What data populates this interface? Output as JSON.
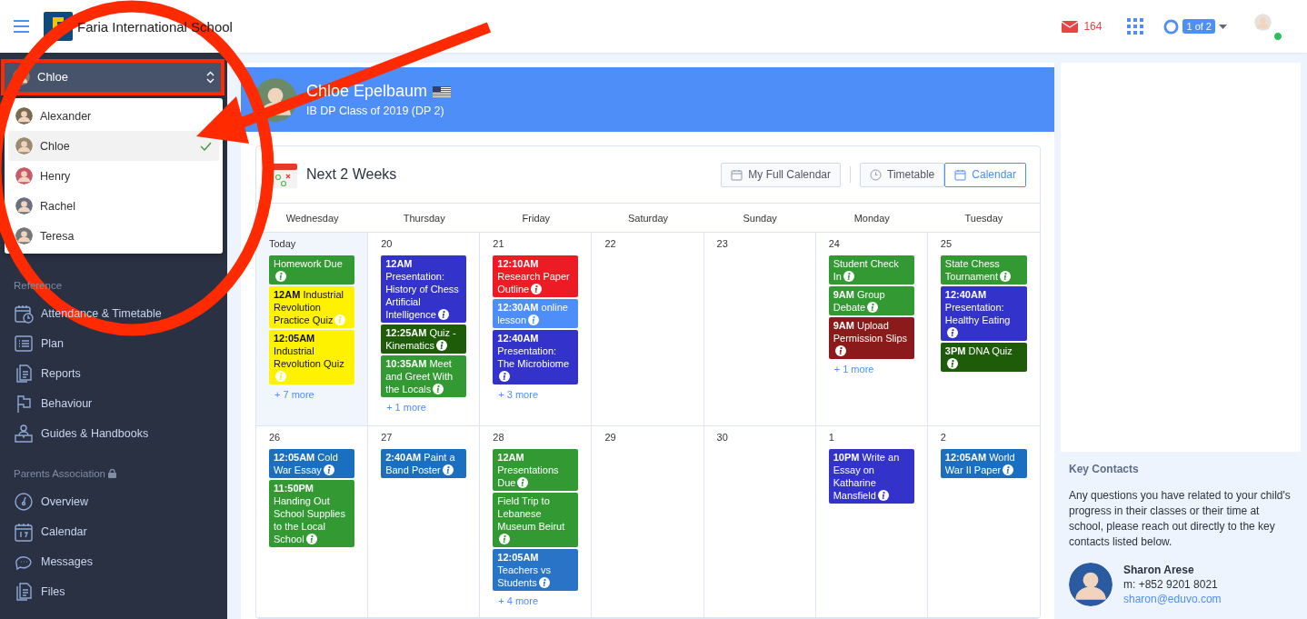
{
  "header": {
    "school_name": "Faria International School",
    "mail_count": "164",
    "account_switch": "1 of 2",
    "online": true
  },
  "sidebar": {
    "student_selector": {
      "value": "Chloe",
      "expanded": true
    },
    "student_menu": [
      {
        "name": "Alexander",
        "selected": false
      },
      {
        "name": "Chloe",
        "selected": true
      },
      {
        "name": "Henry",
        "selected": false
      },
      {
        "name": "Rachel",
        "selected": false
      },
      {
        "name": "Teresa",
        "selected": false
      }
    ],
    "sections": [
      {
        "heading": "Reference",
        "locked": false,
        "items": [
          {
            "label": "Attendance & Timetable",
            "kind": "calendar-clock"
          },
          {
            "label": "Plan",
            "kind": "list"
          },
          {
            "label": "Reports",
            "kind": "document"
          },
          {
            "label": "Behaviour",
            "kind": "flag"
          },
          {
            "label": "Guides & Handbooks",
            "kind": "reader"
          }
        ]
      },
      {
        "heading": "Parents Association",
        "locked": true,
        "items": [
          {
            "label": "Overview",
            "kind": "gauge"
          },
          {
            "label": "Calendar",
            "kind": "calendar"
          },
          {
            "label": "Messages",
            "kind": "chat"
          },
          {
            "label": "Files",
            "kind": "document"
          }
        ]
      }
    ]
  },
  "banner": {
    "name": "Chloe Epelbaum",
    "subtitle": "IB DP Class of 2019 (DP 2)"
  },
  "calendar": {
    "title": "Next 2 Weeks",
    "full_calendar_button": "My Full Calendar",
    "views": [
      {
        "label": "Timetable",
        "kind": "clock",
        "selected": false
      },
      {
        "label": "Calendar",
        "kind": "calendar",
        "selected": true
      }
    ],
    "weekdays": [
      "Wednesday",
      "Thursday",
      "Friday",
      "Saturday",
      "Sunday",
      "Monday",
      "Tuesday"
    ],
    "weeks": [
      [
        {
          "day": "Today",
          "today": true,
          "events": [
            {
              "text": "Homework Due",
              "color": "#339933"
            },
            {
              "text": "**12AM** Industrial Revolution Practice Quiz",
              "color": "#fff200"
            },
            {
              "text": "**12:05AM** Industrial Revolution Quiz",
              "color": "#fff200"
            }
          ],
          "more": "+ 7 more"
        },
        {
          "day": "20",
          "today": false,
          "events": [
            {
              "text": "**12AM** Presentation: History of Chess Artificial Intelligence",
              "color": "#3333cc"
            },
            {
              "text": "**12:25AM** Quiz - Kinematics",
              "color": "#1e5c0a"
            },
            {
              "text": "**10:35AM** Meet and Greet With the Locals",
              "color": "#339933"
            }
          ],
          "more": "+ 1 more"
        },
        {
          "day": "21",
          "today": false,
          "events": [
            {
              "text": "**12:10AM** Research Paper Outline",
              "color": "#ed1c24"
            },
            {
              "text": "**12:30AM** online lesson",
              "color": "#4d8ef8"
            },
            {
              "text": "**12:40AM** Presentation: The Microbiome",
              "color": "#3333cc"
            }
          ],
          "more": "+ 3 more"
        },
        {
          "day": "22",
          "today": false
        },
        {
          "day": "23",
          "today": false
        },
        {
          "day": "24",
          "today": false,
          "events": [
            {
              "text": "Student Check In",
              "color": "#339933"
            },
            {
              "text": "**9AM** Group Debate",
              "color": "#339933"
            },
            {
              "text": "**9AM** Upload Permission Slips",
              "color": "#8b1a1a"
            }
          ],
          "more": "+ 1 more"
        },
        {
          "day": "25",
          "today": false,
          "events": [
            {
              "text": "State Chess Tournament",
              "color": "#339933"
            },
            {
              "text": "**12:40AM** Presentation: Healthy Eating",
              "color": "#3333cc"
            },
            {
              "text": "**3PM** DNA Quiz",
              "color": "#1e5c0a"
            }
          ]
        }
      ],
      [
        {
          "day": "26",
          "today": false,
          "events": [
            {
              "text": "**12:05AM** Cold War Essay",
              "color": "#1a6fc0"
            },
            {
              "text": "**11:50PM** Handing Out School Supplies to the Local School",
              "color": "#339933"
            }
          ]
        },
        {
          "day": "27",
          "today": false,
          "events": [
            {
              "text": "**2:40AM** Paint a Band Poster",
              "color": "#1a6fc0"
            }
          ]
        },
        {
          "day": "28",
          "today": false,
          "events": [
            {
              "text": "**12AM** Presentations Due",
              "color": "#339933"
            },
            {
              "text": "Field Trip to Lebanese Museum Beirut",
              "color": "#339933"
            },
            {
              "text": "**12:05AM** Teachers vs Students",
              "color": "#2a74c8"
            }
          ],
          "more": "+ 4 more"
        },
        {
          "day": "29",
          "today": false
        },
        {
          "day": "30",
          "today": false
        },
        {
          "day": "1",
          "today": false,
          "events": [
            {
              "text": "**10PM** Write an Essay on Katharine Mansfield",
              "color": "#3333cc"
            }
          ]
        },
        {
          "day": "2",
          "today": false,
          "events": [
            {
              "text": "**12:05AM** World War II Paper",
              "color": "#1a6fc0"
            }
          ]
        }
      ]
    ]
  },
  "key_contacts": {
    "heading": "Key Contacts",
    "text": "Any questions you have related to your child's progress in their classes or their time at school, please reach out directly to the key contacts listed below.",
    "contact": {
      "name": "Sharon Arese",
      "phone": "m: +852 9201 8021",
      "email": "sharon@eduvo.com"
    }
  }
}
